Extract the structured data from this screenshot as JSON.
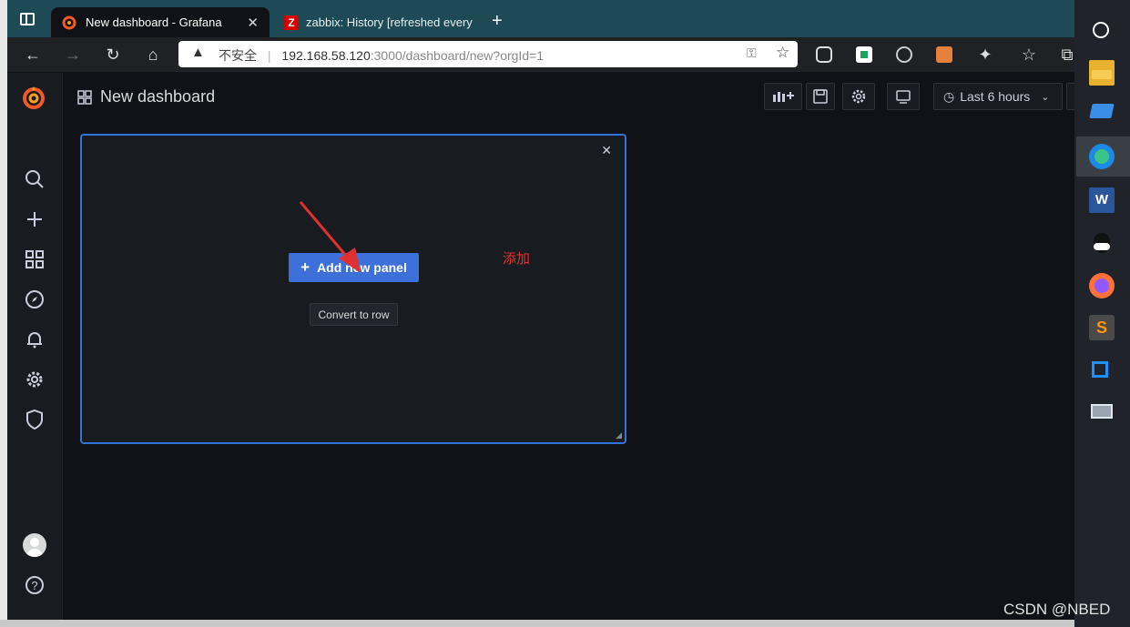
{
  "browser": {
    "tabs": [
      {
        "title": "New dashboard - Grafana",
        "active": true
      },
      {
        "title": "zabbix: History [refreshed every",
        "active": false
      }
    ],
    "address": {
      "security_label": "不安全",
      "url_host": "192.168.58.120",
      "url_rest": ":3000/dashboard/new?orgId=1"
    }
  },
  "grafana": {
    "dashboard_title": "New dashboard",
    "toolbar": {
      "time_range": "Last 6 hours"
    },
    "panel": {
      "add_button": "Add new panel",
      "convert_button": "Convert to row"
    }
  },
  "annotation": {
    "note": "添加"
  },
  "watermark": "CSDN @NBED",
  "colors": {
    "accent_blue": "#3d71d9",
    "panel_border": "#3274d9",
    "annotation_red": "#e03131",
    "grafana_orange": "#f05a28"
  }
}
